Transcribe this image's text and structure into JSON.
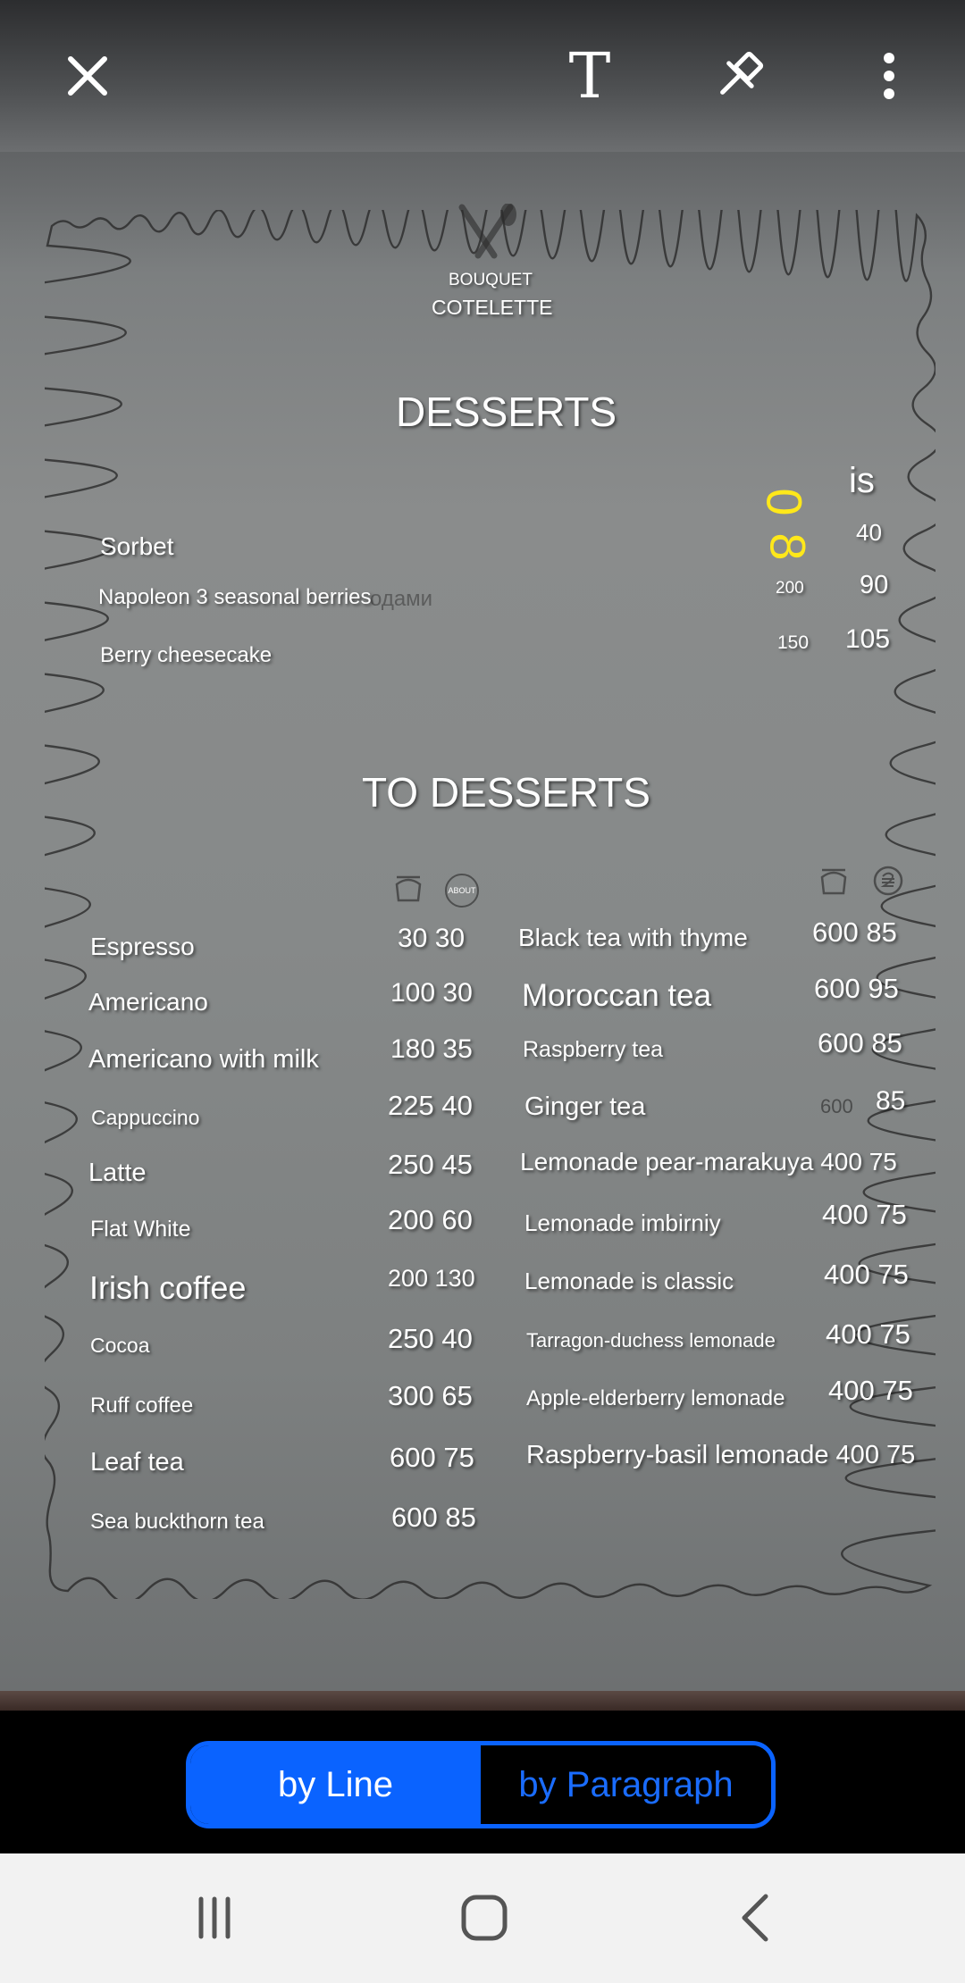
{
  "toolbar": {
    "close_icon": "close-icon",
    "text_icon": "text-format-icon",
    "text_glyph": "T",
    "pin_icon": "pin-icon",
    "more_icon": "more-vertical-icon"
  },
  "menu": {
    "brand_small": "BOUQUET",
    "brand_large": "COTELETTE",
    "desserts_heading": "DESSERTS",
    "yellow_marks": {
      "first": "0",
      "second": "8"
    },
    "col_header": "is",
    "desserts": [
      {
        "name": "Sorbet",
        "weight": "",
        "price": "40"
      },
      {
        "name": "Napoleon 3 seasonal berries",
        "weight": "200",
        "price": "90"
      },
      {
        "name": "Berry cheesecake",
        "weight": "150",
        "price": "105"
      }
    ],
    "ghost_text": "одами",
    "to_desserts_heading": "TO DESSERTS",
    "about_badge": "ABOUT",
    "drinks_left": [
      {
        "name": "Espresso",
        "values": "30 30"
      },
      {
        "name": "Americano",
        "values": "100 30"
      },
      {
        "name": "Americano with milk",
        "values": "180 35"
      },
      {
        "name": "Cappuccino",
        "values": "225 40"
      },
      {
        "name": "Latte",
        "values": "250 45"
      },
      {
        "name": "Flat White",
        "values": "200 60"
      },
      {
        "name": "Irish coffee",
        "values": "200 130"
      },
      {
        "name": "Cocoa",
        "values": "250 40"
      },
      {
        "name": "Ruff coffee",
        "values": "300 65"
      },
      {
        "name": "Leaf tea",
        "values": "600 75"
      },
      {
        "name": "Sea buckthorn tea",
        "values": "600 85"
      }
    ],
    "drinks_right": [
      {
        "name": "Black tea with thyme",
        "values": "600 85"
      },
      {
        "name": "Moroccan tea",
        "values": "600 95"
      },
      {
        "name": "Raspberry tea",
        "values": "600 85"
      },
      {
        "name": "Ginger tea",
        "weight": "600",
        "values": "85"
      },
      {
        "name": "Lemonade pear-marakuya 400 75",
        "values": ""
      },
      {
        "name": "Lemonade imbirniy",
        "values": "400 75"
      },
      {
        "name": "Lemonade is classic",
        "values": "400 75"
      },
      {
        "name": "Tarragon-duchess lemonade",
        "values": "400 75"
      },
      {
        "name": "Apple-elderberry lemonade",
        "values": "400 75"
      },
      {
        "name": "Raspberry-basil lemonade 400 75",
        "values": ""
      }
    ]
  },
  "mode": {
    "by_line": "by Line",
    "by_paragraph": "by Paragraph",
    "active": "by Line",
    "active_color": "#0a63ff"
  },
  "nav": {
    "recents_icon": "recents-icon",
    "home_icon": "home-icon",
    "back_icon": "back-icon"
  }
}
